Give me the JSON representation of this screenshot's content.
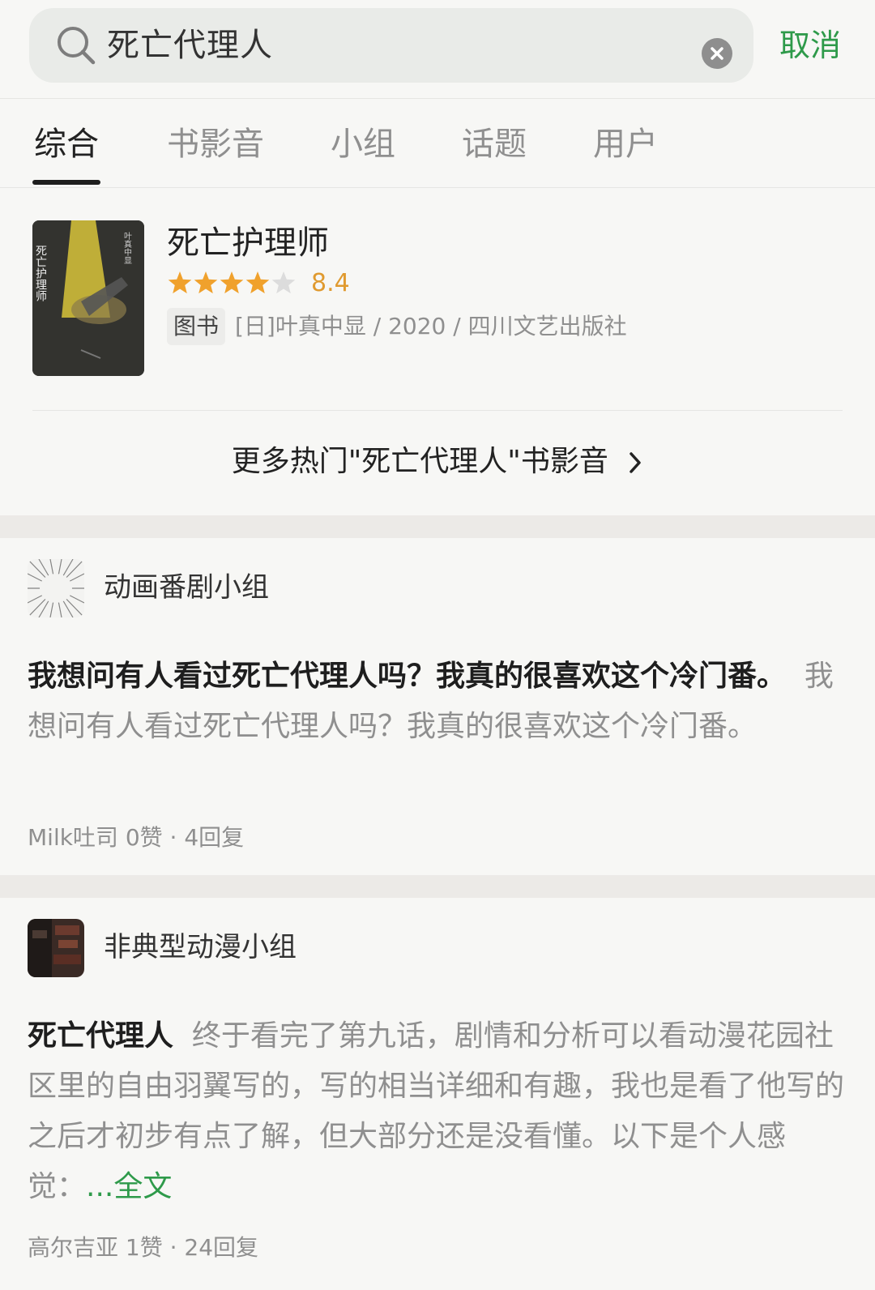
{
  "search": {
    "query": "死亡代理人",
    "cancel_label": "取消"
  },
  "tabs": [
    {
      "label": "综合",
      "active": true
    },
    {
      "label": "书影音",
      "active": false
    },
    {
      "label": "小组",
      "active": false
    },
    {
      "label": "话题",
      "active": false
    },
    {
      "label": "用户",
      "active": false
    }
  ],
  "book": {
    "title": "死亡护理师",
    "rating": "8.4",
    "stars": 4,
    "type_tag": "图书",
    "meta": "[日]叶真中显 / 2020 / 四川文艺出版社",
    "cover_title": "死亡护理师",
    "cover_author": "叶真中显"
  },
  "more_link": "更多热门\"死亡代理人\"书影音",
  "posts": [
    {
      "group": "动画番剧小组",
      "title": "我想问有人看过死亡代理人吗？我真的很喜欢这个冷门番。",
      "excerpt": "我想问有人看过死亡代理人吗？我真的很喜欢这个冷门番。",
      "meta": "Milk吐司 0赞 · 4回复"
    },
    {
      "group": "非典型动漫小组",
      "title": "死亡代理人",
      "excerpt": "终于看完了第九话，剧情和分析可以看动漫花园社区里的自由羽翼写的，写的相当详细和有趣，我也是看了他写的之后才初步有点了解，但大部分还是没看懂。以下是个人感觉：",
      "full_label": "...全文",
      "meta": "高尔吉亚 1赞 · 24回复"
    }
  ],
  "colors": {
    "accent": "#2e9a4a",
    "star": "#f0a12c",
    "rating": "#e09a2f"
  }
}
